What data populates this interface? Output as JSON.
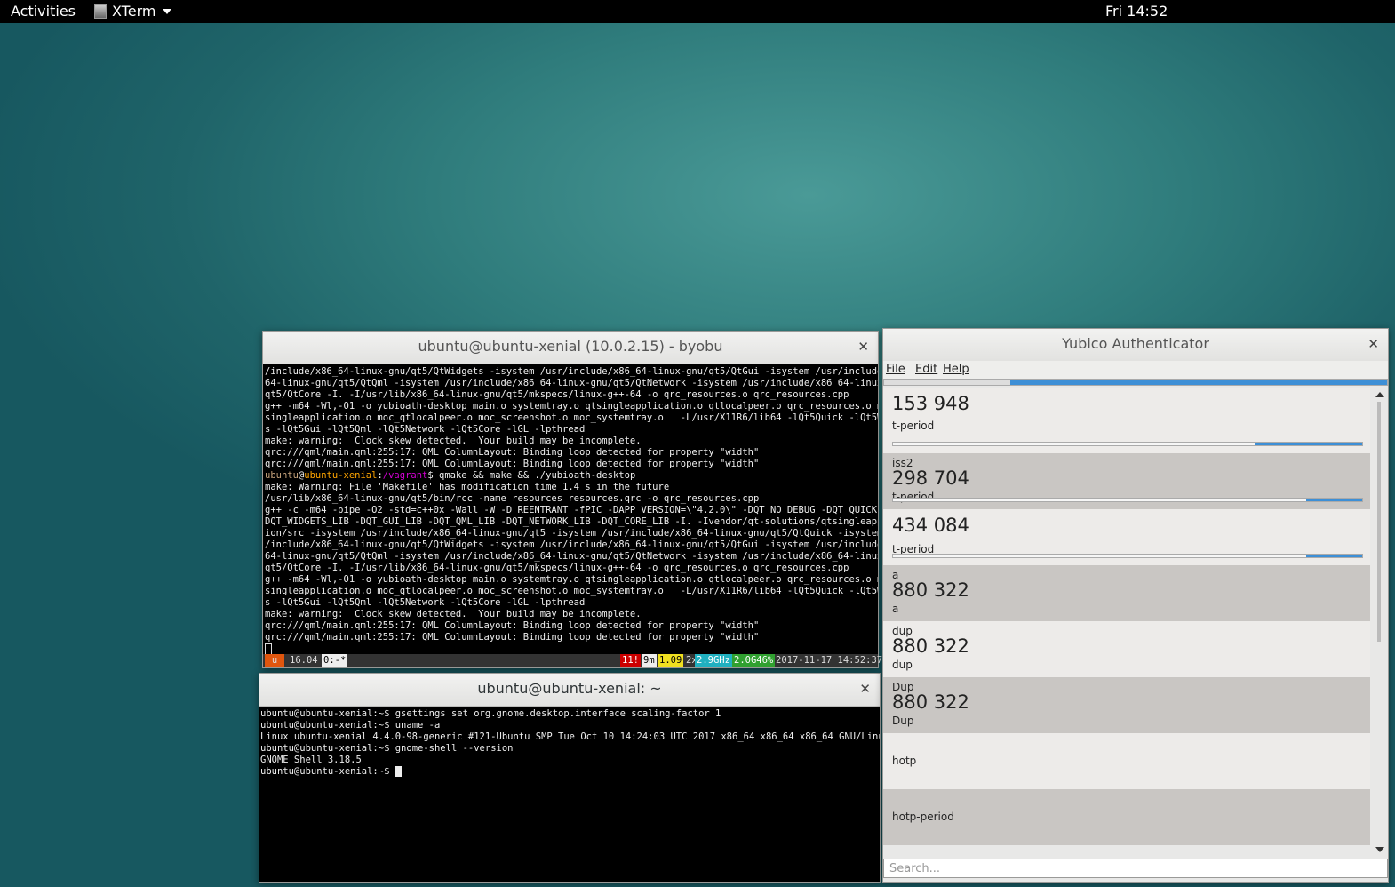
{
  "topbar": {
    "activities": "Activities",
    "app_name": "XTerm",
    "clock": "Fri 14:52"
  },
  "byobu_window": {
    "title": "ubuntu@ubuntu-xenial (10.0.2.15) - byobu",
    "lines": [
      "/include/x86_64-linux-gnu/qt5/QtWidgets -isystem /usr/include/x86_64-linux-gnu/qt5/QtGui -isystem /usr/include/x86_",
      "64-linux-gnu/qt5/QtQml -isystem /usr/include/x86_64-linux-gnu/qt5/QtNetwork -isystem /usr/include/x86_64-linux-gnu/",
      "qt5/QtCore -I. -I/usr/lib/x86_64-linux-gnu/qt5/mkspecs/linux-g++-64 -o qrc_resources.o qrc_resources.cpp",
      "g++ -m64 -Wl,-O1 -o yubioath-desktop main.o systemtray.o qtsingleapplication.o qtlocalpeer.o qrc_resources.o moc_qt",
      "singleapplication.o moc_qtlocalpeer.o moc_screenshot.o moc_systemtray.o   -L/usr/X11R6/lib64 -lQt5Quick -lQt5Widget",
      "s -lQt5Gui -lQt5Qml -lQt5Network -lQt5Core -lGL -lpthread",
      "make: warning:  Clock skew detected.  Your build may be incomplete.",
      "qrc:///qml/main.qml:255:17: QML ColumnLayout: Binding loop detected for property \"width\"",
      "qrc:///qml/main.qml:255:17: QML ColumnLayout: Binding loop detected for property \"width\"",
      "",
      "make: Warning: File 'Makefile' has modification time 1.4 s in the future",
      "/usr/lib/x86_64-linux-gnu/qt5/bin/rcc -name resources resources.qrc -o qrc_resources.cpp",
      "g++ -c -m64 -pipe -O2 -std=c++0x -Wall -W -D_REENTRANT -fPIC -DAPP_VERSION=\\\"4.2.0\\\" -DQT_NO_DEBUG -DQT_QUICK_LIB -",
      "DQT_WIDGETS_LIB -DQT_GUI_LIB -DQT_QML_LIB -DQT_NETWORK_LIB -DQT_CORE_LIB -I. -Ivendor/qt-solutions/qtsingleapplicat",
      "ion/src -isystem /usr/include/x86_64-linux-gnu/qt5 -isystem /usr/include/x86_64-linux-gnu/qt5/QtQuick -isystem /usr",
      "/include/x86_64-linux-gnu/qt5/QtWidgets -isystem /usr/include/x86_64-linux-gnu/qt5/QtGui -isystem /usr/include/x86_",
      "64-linux-gnu/qt5/QtQml -isystem /usr/include/x86_64-linux-gnu/qt5/QtNetwork -isystem /usr/include/x86_64-linux-gnu/",
      "qt5/QtCore -I. -I/usr/lib/x86_64-linux-gnu/qt5/mkspecs/linux-g++-64 -o qrc_resources.o qrc_resources.cpp",
      "g++ -m64 -Wl,-O1 -o yubioath-desktop main.o systemtray.o qtsingleapplication.o qtlocalpeer.o qrc_resources.o moc_qt",
      "singleapplication.o moc_qtlocalpeer.o moc_screenshot.o moc_systemtray.o   -L/usr/X11R6/lib64 -lQt5Quick -lQt5Widget",
      "s -lQt5Gui -lQt5Qml -lQt5Network -lQt5Core -lGL -lpthread",
      "make: warning:  Clock skew detected.  Your build may be incomplete.",
      "qrc:///qml/main.qml:255:17: QML ColumnLayout: Binding loop detected for property \"width\"",
      "qrc:///qml/main.qml:255:17: QML ColumnLayout: Binding loop detected for property \"width\""
    ],
    "prompt": {
      "user": "ubuntu",
      "at": "@",
      "host": "ubuntu-xenial",
      "colon": ":",
      "path": "/vagrant",
      "symbol": "$",
      "command": " qmake && make && ./yubioath-desktop"
    },
    "status": {
      "logo": "u",
      "release": "16.04",
      "window": "0:-*",
      "updates": "11!",
      "memory": "9m",
      "load": "1.09",
      "cpu_count": "2x",
      "cpu_freq": "2.9GHz",
      "mem_usage": "2.0G46%",
      "datetime": "2017-11-17 14:52:37",
      "colors": {
        "logo_bg": "#e0560e",
        "updates_bg": "#cc0000",
        "load_bg": "#f0e020",
        "cpu_bg": "#20b0c0",
        "mem_bg": "#30a030"
      }
    }
  },
  "home_window": {
    "title": "ubuntu@ubuntu-xenial: ~",
    "prompt": "ubuntu@ubuntu-xenial:~$",
    "lines": [
      {
        "prompt": true,
        "text": " gsettings set org.gnome.desktop.interface scaling-factor 1"
      },
      {
        "prompt": true,
        "text": " uname -a"
      },
      {
        "prompt": false,
        "text": "Linux ubuntu-xenial 4.4.0-98-generic #121-Ubuntu SMP Tue Oct 10 14:24:03 UTC 2017 x86_64 x86_64 x86_64 GNU/Linux"
      },
      {
        "prompt": true,
        "text": " gnome-shell --version"
      },
      {
        "prompt": false,
        "text": "GNOME Shell 3.18.5"
      },
      {
        "prompt": true,
        "text": " "
      }
    ]
  },
  "yubico": {
    "title": "Yubico Authenticator",
    "menu": {
      "file": "File",
      "edit": "Edit",
      "help": "Help"
    },
    "global_progress": 0.75,
    "credentials": [
      {
        "issuer": "",
        "code": "153 948",
        "name": "t-period",
        "progress": 0.23
      },
      {
        "issuer": "iss2",
        "code": "298 704",
        "name": "t-period",
        "progress": 0.12
      },
      {
        "issuer": "",
        "code": "434 084",
        "name": "t-period",
        "progress": 0.12
      },
      {
        "issuer": "a",
        "code": "880 322",
        "name": "a",
        "progress": null
      },
      {
        "issuer": "dup",
        "code": "880 322",
        "name": "dup",
        "progress": null
      },
      {
        "issuer": "Dup",
        "code": "880 322",
        "name": "Dup",
        "progress": null
      },
      {
        "issuer": "",
        "code": "",
        "name": "hotp",
        "progress": null
      },
      {
        "issuer": "",
        "code": "",
        "name": "hotp-period",
        "progress": null
      }
    ],
    "search_placeholder": "Search...",
    "accent_color": "#3d8fd6"
  }
}
